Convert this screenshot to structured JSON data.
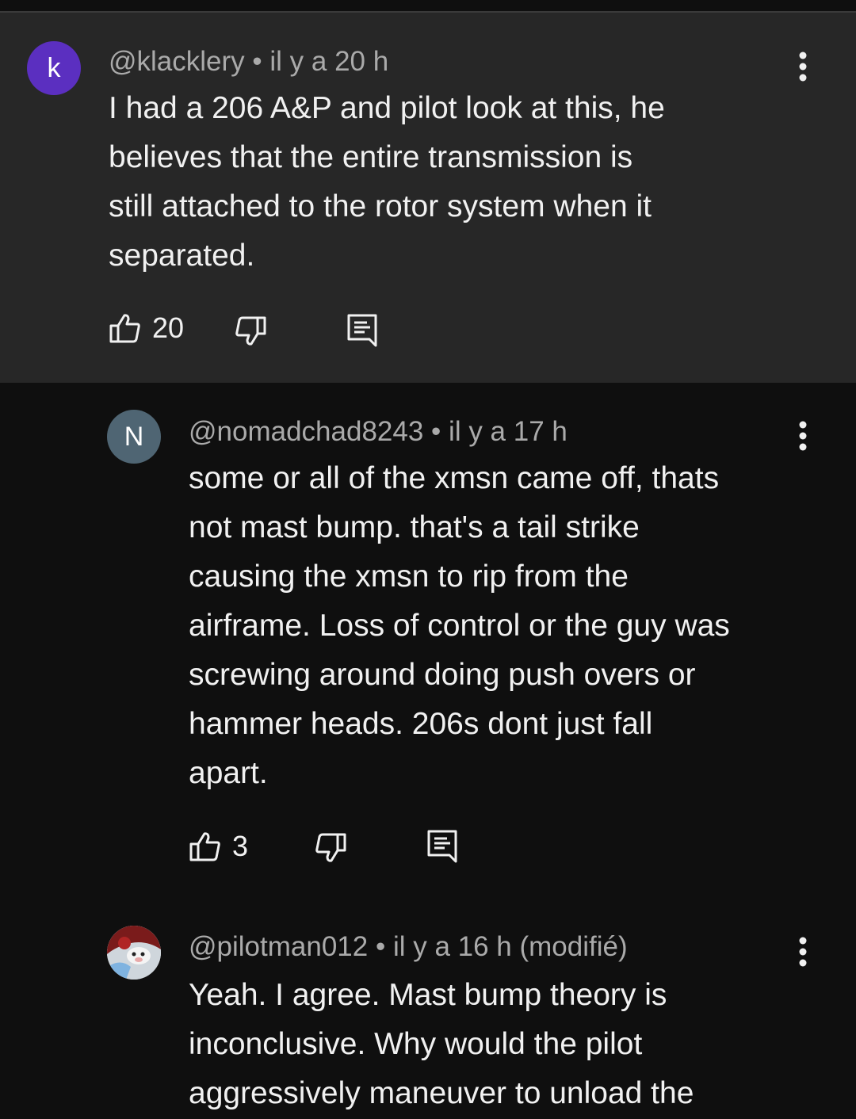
{
  "comments": [
    {
      "author": "@klacklery",
      "sep": "•",
      "time": "il y a 20 h",
      "avatar_letter": "k",
      "avatar_color": "#5b2fc0",
      "lines": [
        "I had a 206 A&P and pilot look at this, he",
        "believes that the entire transmission is",
        "still attached to the rotor system when it",
        "separated."
      ],
      "likes": "20"
    },
    {
      "author": "@nomadchad8243",
      "sep": "•",
      "time": "il y a 17 h",
      "avatar_letter": "N",
      "avatar_color": "#4f6573",
      "lines": [
        "some or all of the xmsn came off, thats",
        "not mast bump. that's a tail strike",
        "causing the xmsn to rip from the",
        "airframe. Loss of control or the guy was",
        "screwing around doing push overs or",
        "hammer heads. 206s dont just fall",
        "apart."
      ],
      "likes": "3"
    },
    {
      "author": "@pilotman012",
      "sep": "•",
      "time": "il y a 16 h",
      "edited": "(modifié)",
      "lines": [
        "Yeah. I agree. Mast bump theory is",
        "inconclusive. Why would the pilot",
        "aggressively maneuver to unload the"
      ]
    }
  ],
  "icons": {
    "like": "thumbs-up-icon",
    "dislike": "thumbs-down-icon",
    "reply": "reply-icon",
    "more": "more-vert-icon"
  }
}
